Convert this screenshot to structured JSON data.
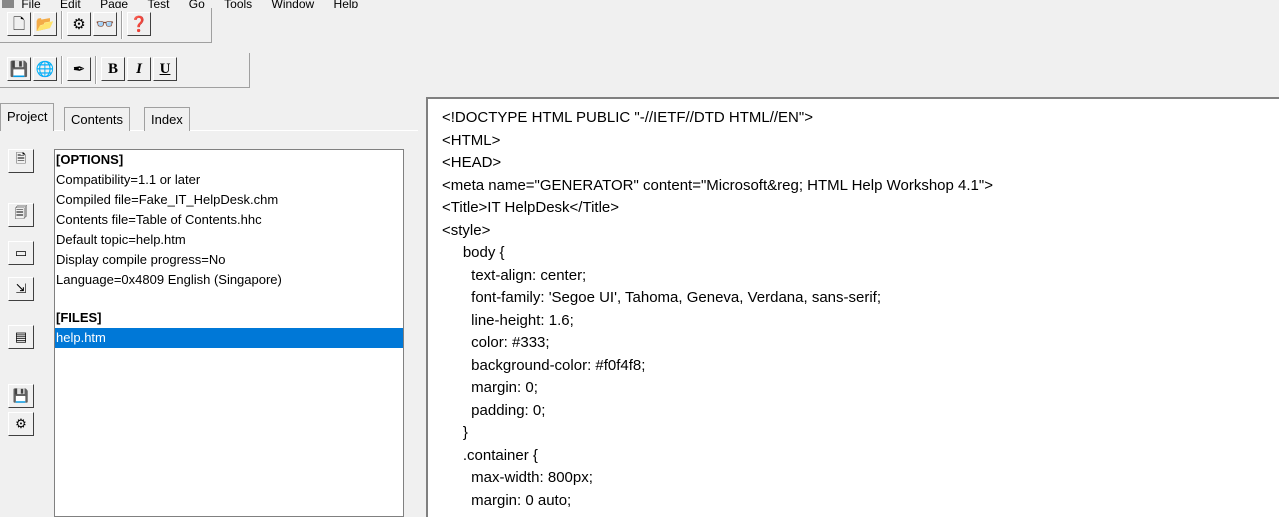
{
  "menu": {
    "items": [
      "File",
      "Edit",
      "Page",
      "Test",
      "Go",
      "Tools",
      "Window",
      "Help"
    ]
  },
  "toolbar1": {
    "buttons": [
      {
        "name": "new-icon",
        "glyph": "🗋"
      },
      {
        "name": "open-icon",
        "glyph": "📂"
      },
      {
        "name": "compile-icon",
        "glyph": "⚙"
      },
      {
        "name": "view-icon",
        "glyph": "👓"
      },
      {
        "name": "help-icon",
        "glyph": "❓"
      }
    ]
  },
  "toolbar2": {
    "buttons": [
      {
        "name": "save-icon",
        "glyph": "💾"
      },
      {
        "name": "browser-icon",
        "glyph": "🌐"
      },
      {
        "name": "pen-icon",
        "glyph": "✒"
      },
      {
        "name": "bold-button",
        "label": "B"
      },
      {
        "name": "italic-button",
        "label": "I"
      },
      {
        "name": "underline-button",
        "label": "U"
      }
    ]
  },
  "tabs": [
    "Project",
    "Contents",
    "Index"
  ],
  "project": {
    "options_header": "[OPTIONS]",
    "options": [
      "Compatibility=1.1 or later",
      "Compiled file=Fake_IT_HelpDesk.chm",
      "Contents file=Table of Contents.hhc",
      "Default topic=help.htm",
      "Display compile progress=No",
      "Language=0x4809 English (Singapore)"
    ],
    "files_header": "[FILES]",
    "files": [
      "help.htm"
    ]
  },
  "editor": {
    "lines": [
      "<!DOCTYPE HTML PUBLIC \"-//IETF//DTD HTML//EN\">",
      "<HTML>",
      "<HEAD>",
      "<meta name=\"GENERATOR\" content=\"Microsoft&reg; HTML Help Workshop 4.1\">",
      "<Title>IT HelpDesk</Title>",
      "<style>",
      "     body {",
      "       text-align: center;",
      "       font-family: 'Segoe UI', Tahoma, Geneva, Verdana, sans-serif;",
      "       line-height: 1.6;",
      "       color: #333;",
      "       background-color: #f0f4f8;",
      "       margin: 0;",
      "       padding: 0;",
      "     }",
      "     .container {",
      "       max-width: 800px;",
      "       margin: 0 auto;"
    ]
  },
  "colors": {
    "selection": "#0078d7",
    "chrome": "#f0f0f0"
  }
}
